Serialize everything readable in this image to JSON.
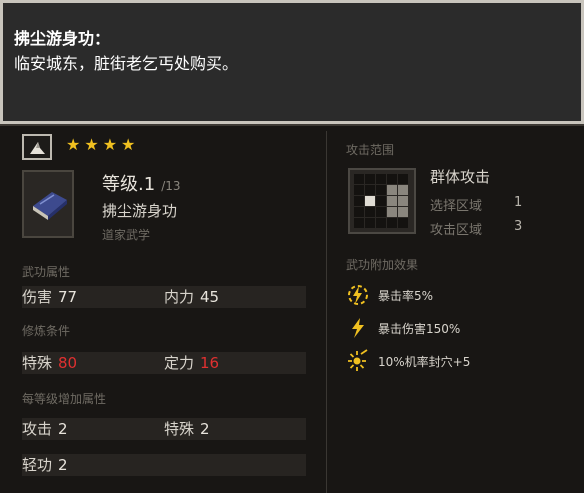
{
  "tooltip": {
    "title": "拂尘游身功：",
    "body": "临安城东，脏街老乞丐处购买。"
  },
  "skill": {
    "stars": [
      "★",
      "★",
      "★",
      "★"
    ],
    "level": "等级.1",
    "max_level": "/13",
    "name": "拂尘游身功",
    "school": "道家武学"
  },
  "sections": {
    "attributes_label": "武功属性",
    "requirements_label": "修炼条件",
    "per_level_label": "每等级增加属性"
  },
  "attributes": [
    {
      "label": "伤害",
      "value": "77"
    },
    {
      "label": "内力",
      "value": "45"
    }
  ],
  "requirements": [
    {
      "label": "特殊",
      "value": "80"
    },
    {
      "label": "定力",
      "value": "16"
    }
  ],
  "per_level": [
    {
      "label": "攻击",
      "value": "2"
    },
    {
      "label": "特殊",
      "value": "2"
    },
    {
      "label": "轻功",
      "value": "2"
    }
  ],
  "attack_range": {
    "label": "攻击范围",
    "type": "群体攻击",
    "select_label": "选择区域",
    "select_value": "1",
    "attack_label": "攻击区域",
    "attack_value": "3"
  },
  "effects": {
    "label": "武功附加效果",
    "items": [
      {
        "icon": "lightning-burst-icon",
        "text": "暴击率5%"
      },
      {
        "icon": "lightning-icon",
        "text": "暴击伤害150%"
      },
      {
        "icon": "acupoint-seal-icon",
        "text": "10%机率封穴+5"
      }
    ]
  },
  "colors": {
    "star": "#f0c020",
    "requirement_unmet": "#e03030"
  }
}
